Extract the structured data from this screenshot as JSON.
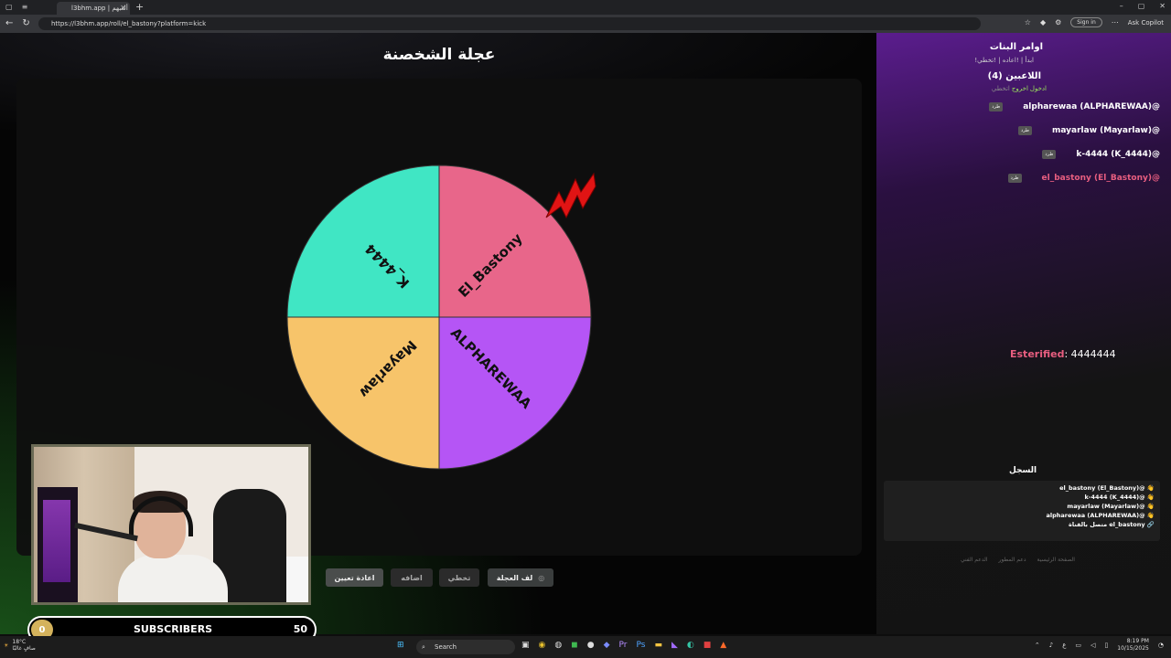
{
  "browser": {
    "tab_title": "l3bhm.app | ألعبهم",
    "tab_close": "✕",
    "new_tab": "+",
    "url": "https://l3bhm.app/roll/el_bastony?platform=kick",
    "sign_in": "Sign in",
    "copilot": "Ask Copilot",
    "win_controls": [
      "–",
      "▢",
      "✕"
    ]
  },
  "main": {
    "title": "عجلة الشخصنة",
    "wheel": {
      "slices": [
        {
          "label": "El_Bastony",
          "color": "#e8668a"
        },
        {
          "label": "ALPHAREWAA",
          "color": "#b555f5"
        },
        {
          "label": "Mayarlaw",
          "color": "#f7c46a"
        },
        {
          "label": "K_4444",
          "color": "#40e6c4"
        }
      ],
      "marker_color": "#e11414"
    },
    "buttons": {
      "spin": "لف العجلة",
      "skip": "تخطي",
      "add": "اضافه",
      "reset": "اعادة تعيين"
    }
  },
  "sidebar": {
    "title": "اوامر البنات",
    "commands": "!ابدأ | !اعاده | !تخطي",
    "players_title": "اللاعبين (4)",
    "links": {
      "join": "ادخول",
      "leave": "اخروج",
      "skip": "اتخطي"
    },
    "kick_label": "طرد",
    "players": [
      "alpharewaa (ALPHAREWAA)@",
      "mayarlaw (Mayarlaw)@",
      "k-4444 (K_4444)@",
      "el_bastony (El_Bastony)@"
    ],
    "esterified_name": "Esterified",
    "esterified_text": ": 4444444",
    "log_title": "السجل",
    "log": [
      "el_bastony (El_Bastony)@ 👋",
      "k-4444 (K_4444)@ 👋",
      "mayarlaw (Mayarlaw)@ 👋",
      "alpharewaa (ALPHAREWAA)@ 👋",
      "متصل بالقناة el_bastony 🔗"
    ],
    "footer": [
      "الصفحة الرئيسية",
      "دعم المطور",
      "الدعم الفني"
    ]
  },
  "overlay": {
    "subs_count_left": "0",
    "subs_label": "SUBSCRIBERS",
    "subs_goal": "50"
  },
  "taskbar": {
    "weather_temp": "18°C",
    "weather_desc": "صافٍ غالبًا",
    "search": "Search",
    "lang": "ع",
    "time": "8:19 PM",
    "date": "10/15/2025"
  }
}
